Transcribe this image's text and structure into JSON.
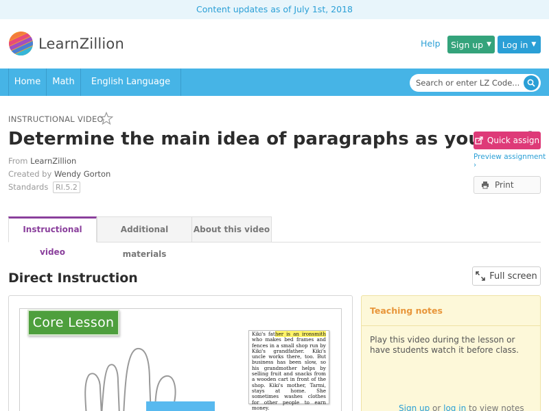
{
  "banner": {
    "text": "Content updates as of July 1st, 2018"
  },
  "header": {
    "logo_text": "LearnZillion",
    "help": "Help",
    "signup": "Sign up",
    "login": "Log in"
  },
  "nav": {
    "items": [
      {
        "label": "Home"
      },
      {
        "label": "Math"
      },
      {
        "label": "English Language Arts"
      }
    ],
    "search_placeholder": "Search or enter LZ Code..."
  },
  "lesson": {
    "kicker": "INSTRUCTIONAL VIDEO",
    "title": "Determine the main idea of paragraphs as you read",
    "from_label": "From",
    "from_value": "LearnZillion",
    "created_label": "Created by",
    "created_value": "Wendy Gorton",
    "standards_label": "Standards",
    "standard": "RI.5.2"
  },
  "actions": {
    "quick_assign": "Quick assign",
    "preview": "Preview assignment ›",
    "print": "Print"
  },
  "tabs": [
    {
      "label": "Instructional video"
    },
    {
      "label": "Additional materials"
    },
    {
      "label": "About this video"
    }
  ],
  "section": {
    "title": "Direct Instruction",
    "fullscreen": "Full screen"
  },
  "video": {
    "badge": "Core Lesson",
    "excerpt_pre": "Kiki's fat",
    "excerpt_hl": "her is an ironsmith",
    "excerpt_rest": " who makes bed frames and fences in a small shop run by Kiki's grandfather. Kiki's uncle works there, too. But business has been slow, so his grandmother helps by selling fruit and snacks from a wooden cart in front of the shop. Kiki's mother, Tarmi, stays at home. She sometimes washes clothes for other people to earn money."
  },
  "notes": {
    "heading": "Teaching notes",
    "body": "Play this video during the lesson or have students watch it before class.",
    "signup": "Sign up",
    "or": " or ",
    "login": "log in",
    "suffix": " to view notes"
  },
  "colors": {
    "nav_blue": "#46b4e6",
    "link_blue": "#2a9fd6",
    "signup_green": "#34a37b",
    "quick_assign_pink": "#de3a78",
    "tab_active_purple": "#8a3f9c",
    "notes_orange": "#e8963a"
  }
}
